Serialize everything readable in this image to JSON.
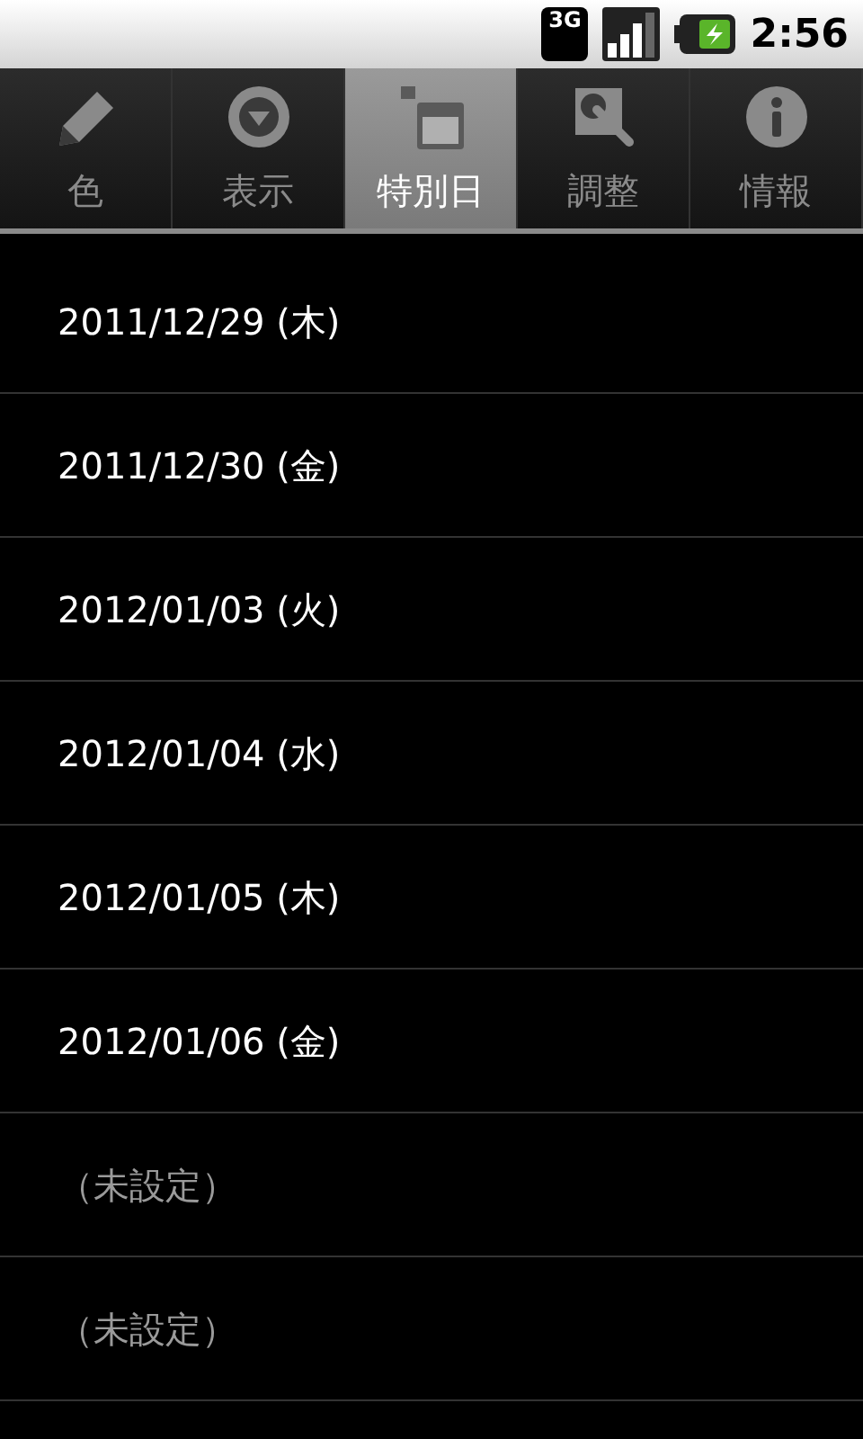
{
  "status_bar": {
    "network": "3G",
    "time": "2:56"
  },
  "tabs": [
    {
      "label": "色",
      "kind": "pencil",
      "selected": false
    },
    {
      "label": "表示",
      "kind": "down",
      "selected": false
    },
    {
      "label": "特別日",
      "kind": "calendar",
      "selected": true
    },
    {
      "label": "調整",
      "kind": "wrench",
      "selected": false
    },
    {
      "label": "情報",
      "kind": "info",
      "selected": false
    }
  ],
  "rows": [
    {
      "kind": "date",
      "text": "2011/12/29 (木)"
    },
    {
      "kind": "date",
      "text": "2011/12/30 (金)"
    },
    {
      "kind": "date",
      "text": "2012/01/03 (火)"
    },
    {
      "kind": "date",
      "text": "2012/01/04 (水)"
    },
    {
      "kind": "date",
      "text": "2012/01/05 (木)"
    },
    {
      "kind": "date",
      "text": "2012/01/06 (金)"
    },
    {
      "kind": "unset",
      "text": "（未設定）"
    },
    {
      "kind": "unset",
      "text": "（未設定）"
    }
  ]
}
